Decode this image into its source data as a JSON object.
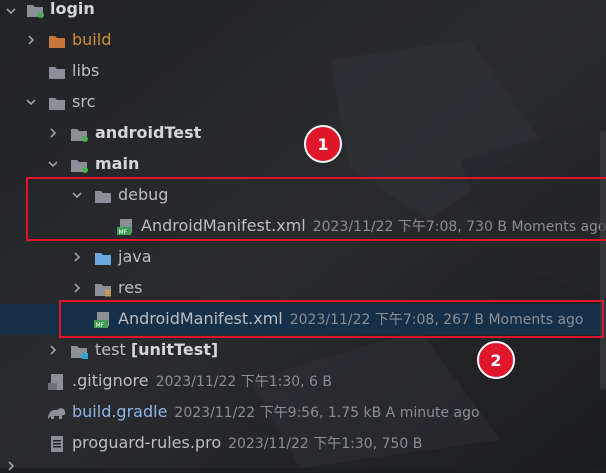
{
  "colors": {
    "background": "#1e1f22",
    "selection": "#17304a",
    "folder": "#8a8f98",
    "excluded_folder": "#c7763a",
    "source_folder": "#6aa9dd",
    "annotation_red": "#e0162b",
    "text_muted": "#8b8e94"
  },
  "tree": [
    {
      "label": "login",
      "icon": "module-folder-icon",
      "expanded": true,
      "bold": true
    },
    {
      "label": "build",
      "icon": "excluded-folder-icon",
      "expanded": false,
      "style": "orange"
    },
    {
      "label": "libs",
      "icon": "folder-icon",
      "expanded": null
    },
    {
      "label": "src",
      "icon": "folder-icon",
      "expanded": true
    },
    {
      "label": "androidTest",
      "icon": "test-folder-icon",
      "expanded": false,
      "bold": true
    },
    {
      "label": "main",
      "icon": "source-root-folder-icon",
      "expanded": true,
      "bold": true
    },
    {
      "label": "debug",
      "icon": "folder-icon",
      "expanded": true
    },
    {
      "label": "AndroidManifest.xml",
      "icon": "manifest-file-icon",
      "meta": "2023/11/22 下午7:08, 730 B Moments ago"
    },
    {
      "label": "java",
      "icon": "source-folder-icon",
      "expanded": false
    },
    {
      "label": "res",
      "icon": "resources-folder-icon",
      "expanded": false
    },
    {
      "label": "AndroidManifest.xml",
      "icon": "manifest-file-icon",
      "meta": "2023/11/22 下午7:08, 267 B Moments ago",
      "selected": true
    },
    {
      "label": "test",
      "label_suffix": "[unitTest]",
      "icon": "test-folder-icon",
      "expanded": false
    },
    {
      "label": ".gitignore",
      "icon": "gitignore-file-icon",
      "meta": "2023/11/22 下午1:30, 6 B"
    },
    {
      "label": "build.gradle",
      "icon": "gradle-file-icon",
      "meta": "2023/11/22 下午9:56, 1.75 kB A minute ago",
      "style": "blue"
    },
    {
      "label": "proguard-rules.pro",
      "icon": "proguard-file-icon",
      "meta": "2023/11/22 下午1:30, 750 B"
    }
  ],
  "annotations": [
    {
      "badge": "1"
    },
    {
      "badge": "2"
    }
  ]
}
